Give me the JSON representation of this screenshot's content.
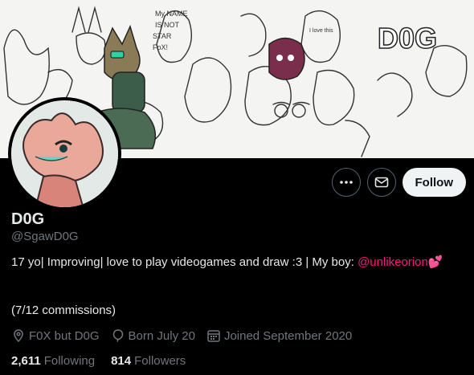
{
  "profile": {
    "display_name": "D0G",
    "handle": "@SgawD0G",
    "bio_text": "17 yo| Improving| love to play videogames and draw  :3 | My boy: ",
    "bio_mention": "@unlikeorion",
    "bio_emoji": "💕",
    "bio_line2": "(7/12 commissions)",
    "location": "F0X but D0G",
    "birthday": "Born July 20",
    "joined": "Joined September 2020",
    "following_count": "2,611",
    "following_label": "Following",
    "followers_count": "814",
    "followers_label": "Followers"
  },
  "actions": {
    "follow_label": "Follow",
    "more_icon": "more-icon",
    "message_icon": "envelope-icon"
  },
  "banner": {
    "doodle_text_1": "My NAME IS NOT STAR FOX!",
    "doodle_text_2": "D0G",
    "doodle_text_3": "I love this"
  },
  "colors": {
    "background": "#000000",
    "text_primary": "#e7e9ea",
    "text_secondary": "#71767b",
    "mention": "#f91880",
    "follow_bg": "#eff3f4",
    "border": "#536471"
  }
}
